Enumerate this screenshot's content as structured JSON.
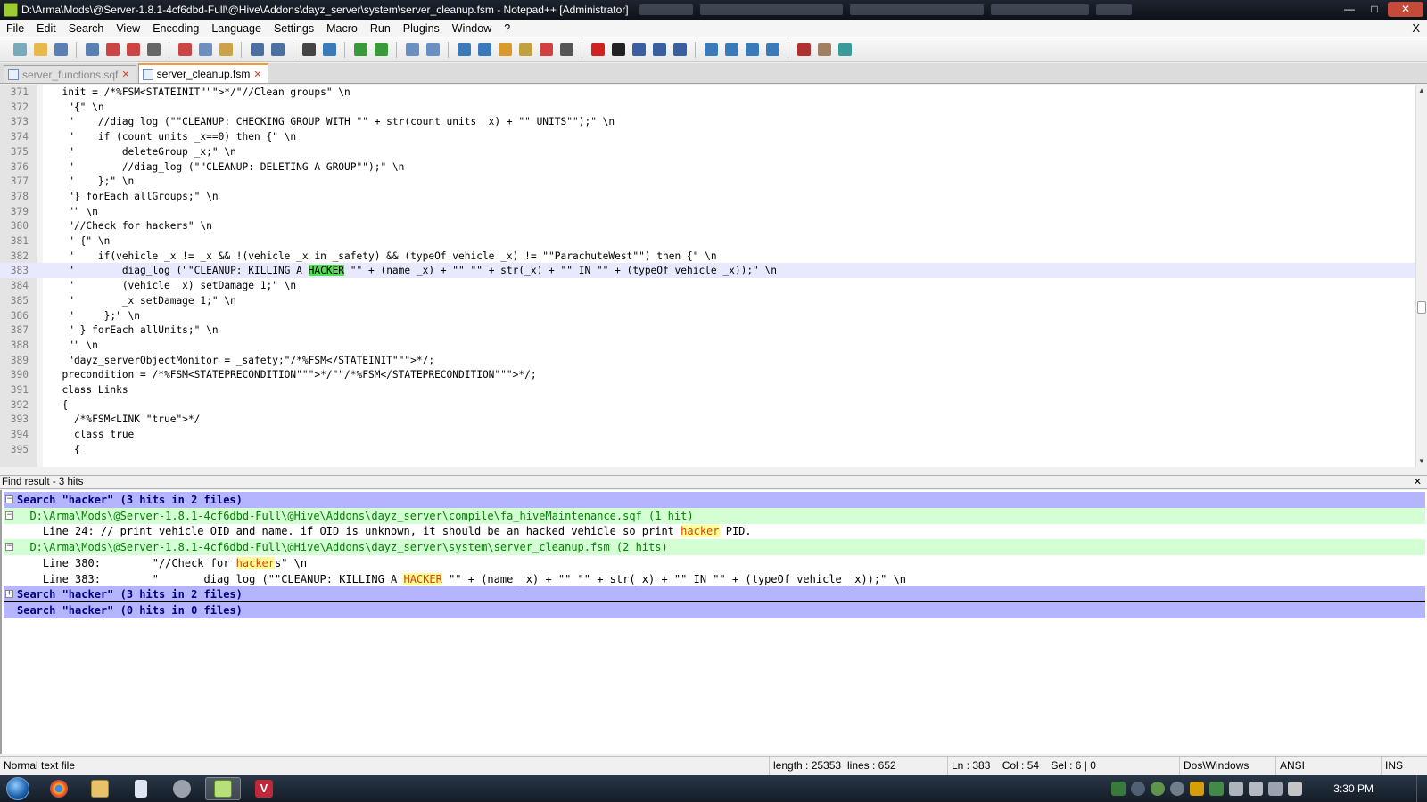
{
  "window": {
    "title": "D:\\Arma\\Mods\\@Server-1.8.1-4cf6dbd-Full\\@Hive\\Addons\\dayz_server\\system\\server_cleanup.fsm - Notepad++ [Administrator]",
    "minimize": "—",
    "maximize": "□",
    "close": "✕"
  },
  "menu": {
    "items": [
      "File",
      "Edit",
      "Search",
      "View",
      "Encoding",
      "Language",
      "Settings",
      "Macro",
      "Run",
      "Plugins",
      "Window",
      "?"
    ],
    "close": "X"
  },
  "toolbar": {
    "icons": [
      "new-file-icon",
      "open-file-icon",
      "save-icon",
      "save-all-icon",
      "close-icon",
      "close-all-icon",
      "print-icon",
      "cut-icon",
      "copy-icon",
      "paste-icon",
      "undo-icon",
      "redo-icon",
      "find-icon",
      "replace-icon",
      "zoom-in-icon",
      "zoom-out-icon",
      "sync-vertical-icon",
      "sync-horizontal-icon",
      "word-wrap-icon",
      "show-all-chars-icon",
      "indent-guide-icon",
      "user-lang-icon",
      "doc-map-icon",
      "function-list-icon",
      "record-macro-icon",
      "stop-macro-icon",
      "play-macro-icon",
      "run-macro-multiple-icon",
      "save-macro-icon",
      "collapse-all-icon",
      "prev-bookmark-icon",
      "next-bookmark-icon",
      "expand-all-icon",
      "spellcheck-icon",
      "spellcheck-toggle-icon",
      "spellcheck-next-icon"
    ]
  },
  "tabs": [
    {
      "label": "server_functions.sqf",
      "close": "✕",
      "active": false
    },
    {
      "label": "server_cleanup.fsm",
      "close": "✕",
      "active": true
    }
  ],
  "editor": {
    "lines": [
      {
        "n": "371",
        "pre": "  init = /*%FSM<STATEINIT\"\"\">*/\"//Clean groups\" \\n",
        "hl": "",
        "post": ""
      },
      {
        "n": "372",
        "pre": "   \"{\" \\n",
        "hl": "",
        "post": ""
      },
      {
        "n": "373",
        "pre": "   \"    //diag_log (\"\"CLEANUP: CHECKING GROUP WITH \"\" + str(count units _x) + \"\" UNITS\"\");\" \\n",
        "hl": "",
        "post": ""
      },
      {
        "n": "374",
        "pre": "   \"    if (count units _x==0) then {\" \\n",
        "hl": "",
        "post": ""
      },
      {
        "n": "375",
        "pre": "   \"        deleteGroup _x;\" \\n",
        "hl": "",
        "post": ""
      },
      {
        "n": "376",
        "pre": "   \"        //diag_log (\"\"CLEANUP: DELETING A GROUP\"\");\" \\n",
        "hl": "",
        "post": ""
      },
      {
        "n": "377",
        "pre": "   \"    };\" \\n",
        "hl": "",
        "post": ""
      },
      {
        "n": "378",
        "pre": "   \"} forEach allGroups;\" \\n",
        "hl": "",
        "post": ""
      },
      {
        "n": "379",
        "pre": "   \"\" \\n",
        "hl": "",
        "post": ""
      },
      {
        "n": "380",
        "pre": "   \"//Check for hackers\" \\n",
        "hl": "",
        "post": ""
      },
      {
        "n": "381",
        "pre": "   \" {\" \\n",
        "hl": "",
        "post": ""
      },
      {
        "n": "382",
        "pre": "   \"    if(vehicle _x != _x && !(vehicle _x in _safety) && (typeOf vehicle _x) != \"\"ParachuteWest\"\") then {\" \\n",
        "hl": "",
        "post": ""
      },
      {
        "n": "383",
        "pre": "   \"        diag_log (\"\"CLEANUP: KILLING A ",
        "hl": "HACKER",
        "post": " \"\" + (name _x) + \"\" \"\" + str(_x) + \"\" IN \"\" + (typeOf vehicle _x));\" \\n",
        "current": true
      },
      {
        "n": "384",
        "pre": "   \"        (vehicle _x) setDamage 1;\" \\n",
        "hl": "",
        "post": ""
      },
      {
        "n": "385",
        "pre": "   \"        _x setDamage 1;\" \\n",
        "hl": "",
        "post": ""
      },
      {
        "n": "386",
        "pre": "   \"     };\" \\n",
        "hl": "",
        "post": ""
      },
      {
        "n": "387",
        "pre": "   \" } forEach allUnits;\" \\n",
        "hl": "",
        "post": ""
      },
      {
        "n": "388",
        "pre": "   \"\" \\n",
        "hl": "",
        "post": ""
      },
      {
        "n": "389",
        "pre": "   \"dayz_serverObjectMonitor = _safety;\"/*%FSM</STATEINIT\"\"\">*/;",
        "hl": "",
        "post": ""
      },
      {
        "n": "390",
        "pre": "  precondition = /*%FSM<STATEPRECONDITION\"\"\">*/\"\"/*%FSM</STATEPRECONDITION\"\"\">*/;",
        "hl": "",
        "post": ""
      },
      {
        "n": "391",
        "pre": "  class Links",
        "hl": "",
        "post": ""
      },
      {
        "n": "392",
        "pre": "  {",
        "hl": "",
        "post": ""
      },
      {
        "n": "393",
        "pre": "    /*%FSM<LINK \"true\">*/",
        "hl": "",
        "post": ""
      },
      {
        "n": "394",
        "pre": "    class true",
        "hl": "",
        "post": ""
      },
      {
        "n": "395",
        "pre": "    {",
        "hl": "",
        "post": ""
      }
    ]
  },
  "find_results": {
    "header": "Find result - 3 hits",
    "close": "✕",
    "lines": [
      {
        "kind": "search",
        "box": "−",
        "pre": "Search \"hacker\" (3 hits in 2 files)",
        "hl": "",
        "post": ""
      },
      {
        "kind": "file",
        "box": "−",
        "pre": "  D:\\Arma\\Mods\\@Server-1.8.1-4cf6dbd-Full\\@Hive\\Addons\\dayz_server\\compile\\fa_hiveMaintenance.sqf (1 hit)",
        "hl": "",
        "post": ""
      },
      {
        "kind": "hit",
        "box": "",
        "pre": "    Line 24: // print vehicle OID and name. if OID is unknown, it should be an hacked vehicle so print ",
        "hl": "hacker",
        "post": " PID."
      },
      {
        "kind": "file",
        "box": "−",
        "pre": "  D:\\Arma\\Mods\\@Server-1.8.1-4cf6dbd-Full\\@Hive\\Addons\\dayz_server\\system\\server_cleanup.fsm (2 hits)",
        "hl": "",
        "post": ""
      },
      {
        "kind": "hit",
        "box": "",
        "pre": "    Line 380:        \"//Check for ",
        "hl": "hacker",
        "post": "s\" \\n"
      },
      {
        "kind": "hit",
        "box": "",
        "pre": "    Line 383:        \"       diag_log (\"\"CLEANUP: KILLING A ",
        "hl": "HACKER",
        "post": " \"\" + (name _x) + \"\" \"\" + str(_x) + \"\" IN \"\" + (typeOf vehicle _x));\" \\n"
      },
      {
        "kind": "search sep",
        "box": "+",
        "pre": "Search \"hacker\" (3 hits in 2 files)",
        "hl": "",
        "post": ""
      },
      {
        "kind": "search",
        "box": "",
        "pre": "Search \"hacker\" (0 hits in 0 files)",
        "hl": "",
        "post": ""
      }
    ]
  },
  "status": {
    "type": "Normal text file",
    "length": "length : 25353",
    "lines": "lines : 652",
    "position": "Ln : 383    Col : 54    Sel : 6 | 0",
    "eol": "Dos\\Windows",
    "encoding": "ANSI",
    "mode": "INS"
  },
  "taskbar": {
    "apps": [
      "chrome-icon",
      "explorer-icon",
      "document-icon",
      "game-icon",
      "notepadpp-icon",
      "vs-icon"
    ],
    "clock": "3:30 PM"
  },
  "colors": {
    "selection_hl": "#55dd55",
    "current_line": "#e8e8ff",
    "search_bg": "#b4b4ff",
    "file_bg": "#d4ffd4",
    "find_hl": "#ffff99"
  }
}
